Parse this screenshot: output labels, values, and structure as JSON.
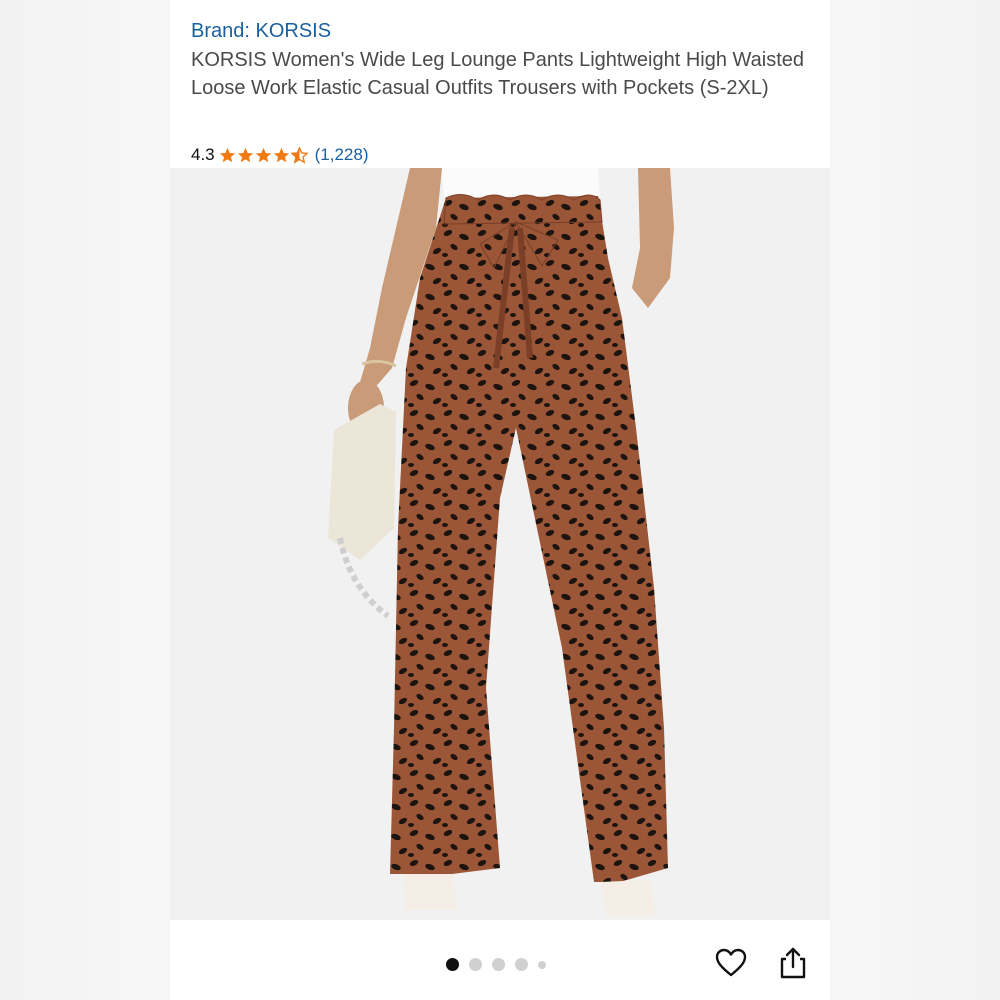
{
  "product": {
    "brand_label": "Brand: KORSIS",
    "title": "KORSIS Women's Wide Leg Lounge Pants Lightweight High Waisted Loose Work Elastic Casual Outfits Trousers with Pockets (S-2XL)",
    "rating_value": "4.3",
    "rating_stars": 4.3,
    "review_count": "(1,228)"
  },
  "gallery": {
    "image_count": 5,
    "active_index": 0,
    "image_subject": "brown-spotted-wide-leg-pants"
  },
  "actions": {
    "favorite_icon": "heart-icon",
    "share_icon": "share-icon"
  },
  "colors": {
    "link": "#1a5f9e",
    "star": "#f07a12",
    "pants": "#9b5638"
  }
}
